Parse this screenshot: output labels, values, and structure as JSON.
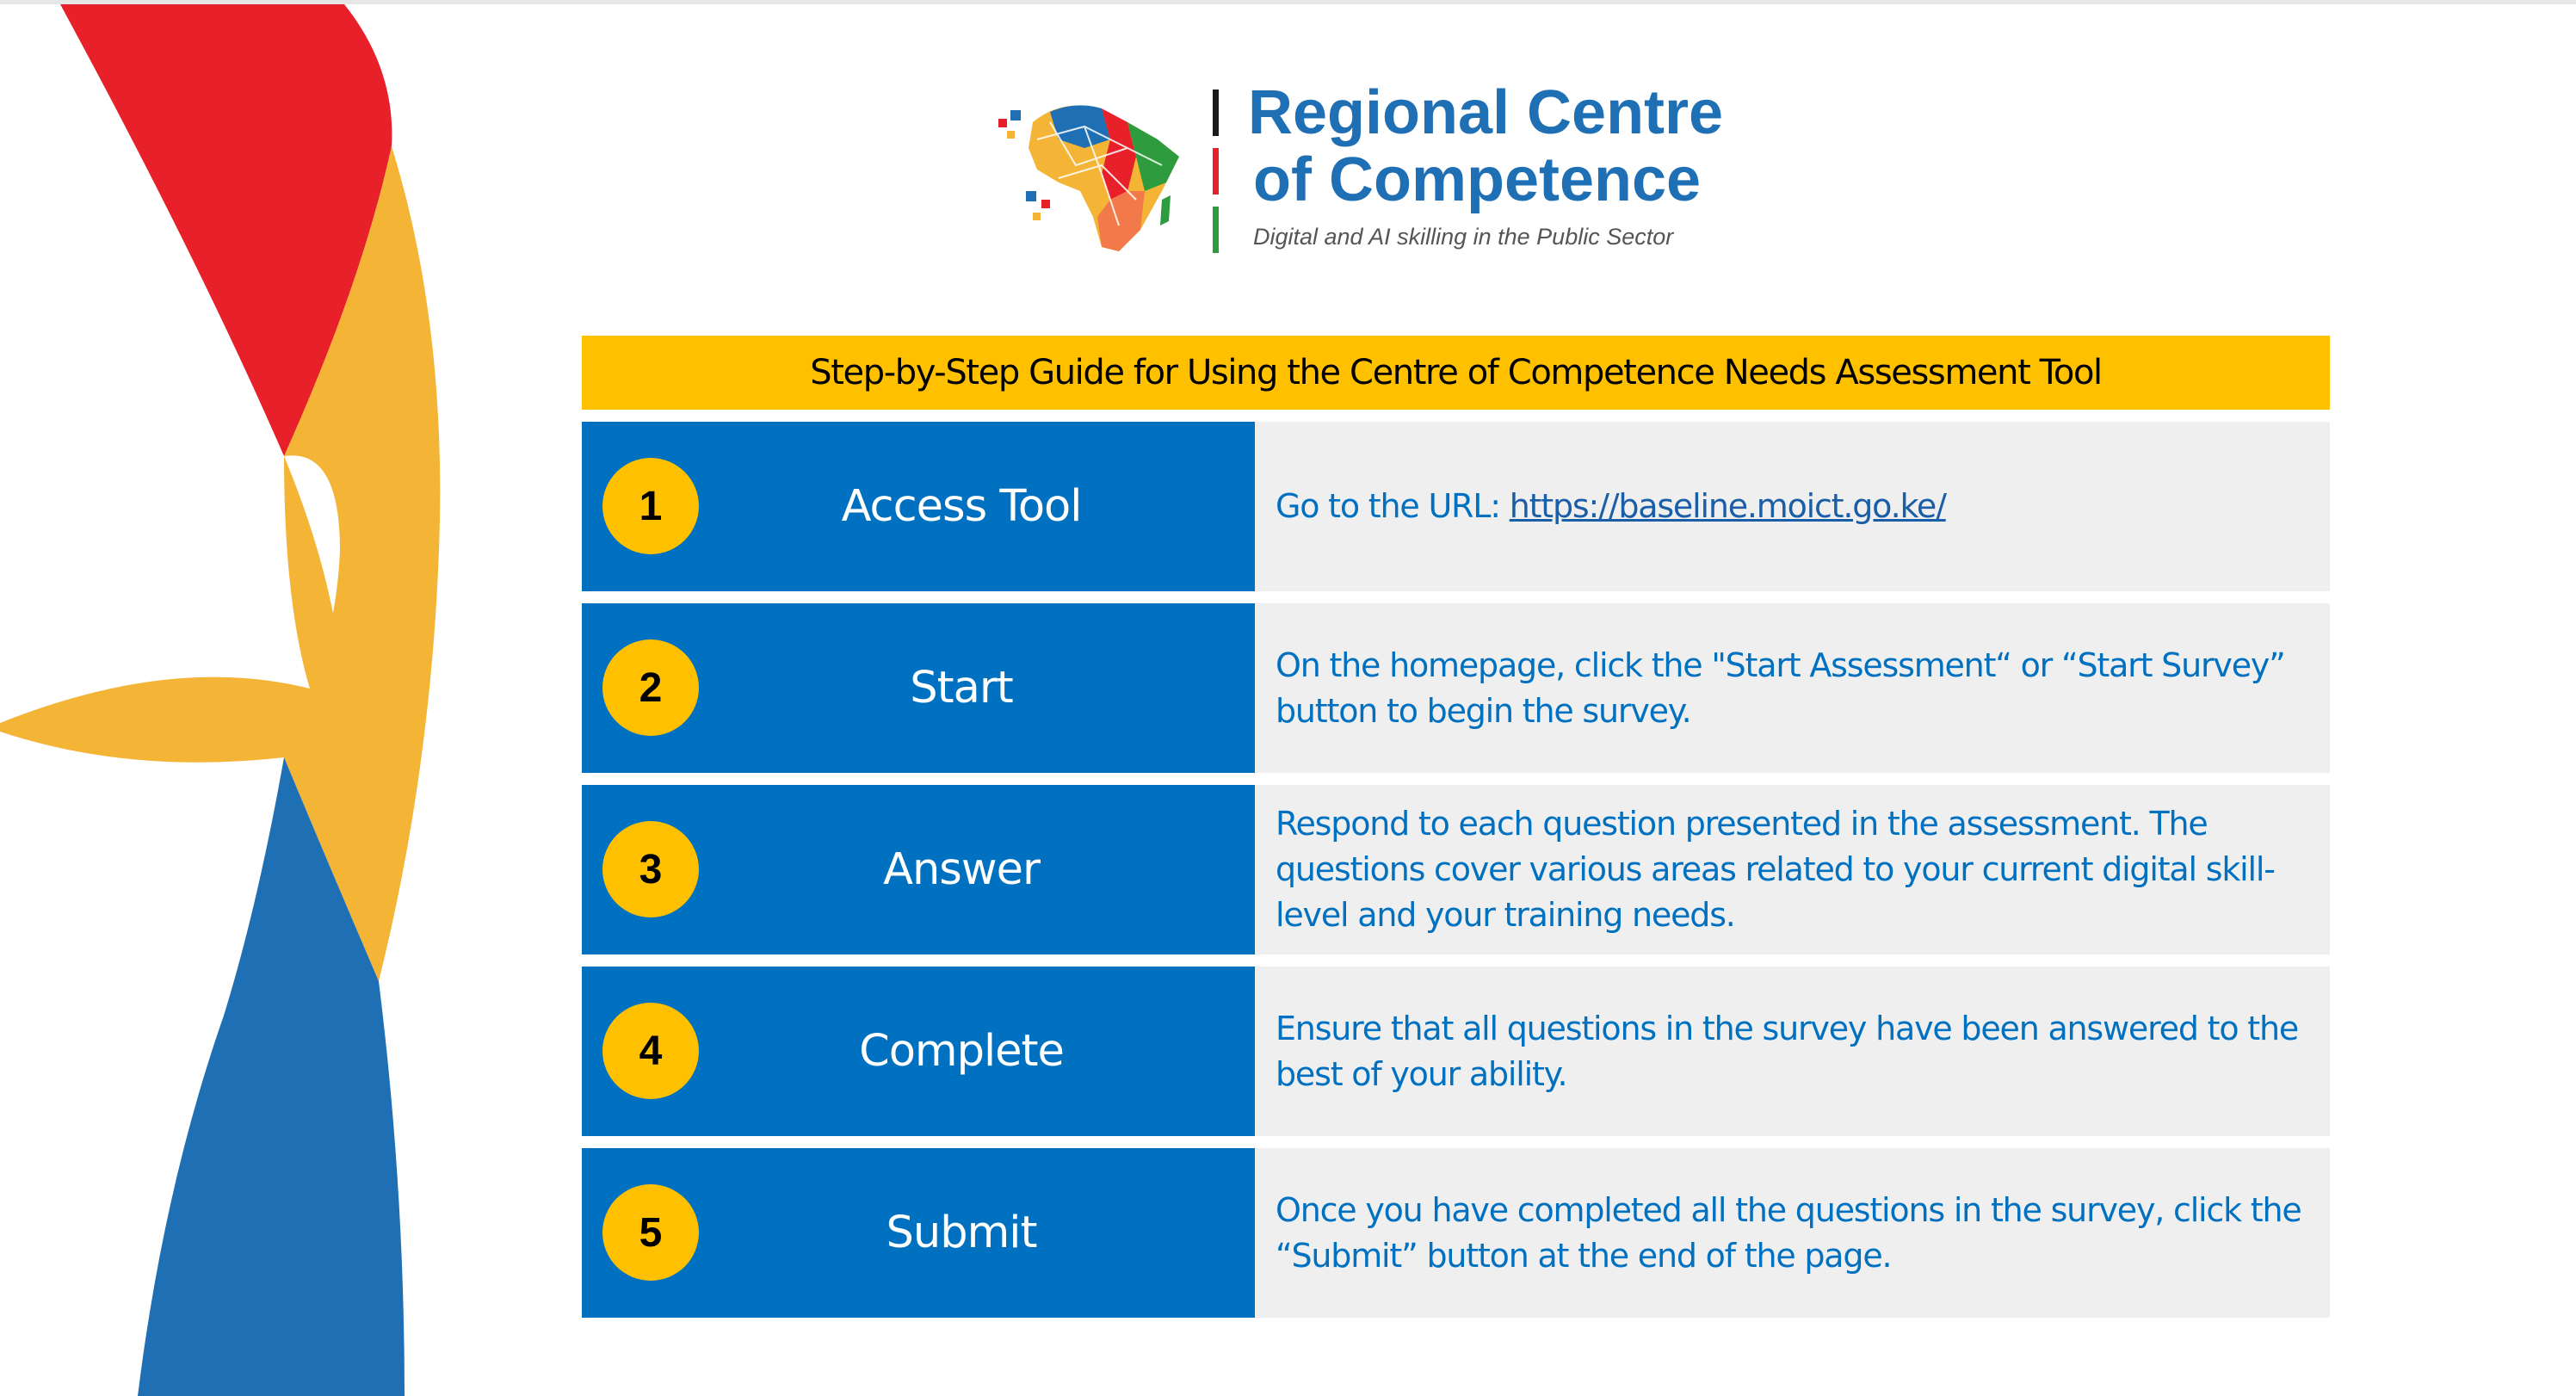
{
  "logo": {
    "title_line1": "Regional Centre",
    "title_line2": "of Competence",
    "tagline": "Digital and AI skilling in the Public Sector",
    "icon": "africa-map-logo-icon"
  },
  "guide": {
    "header": "Step-by-Step Guide for Using the Centre of Competence Needs Assessment Tool",
    "steps": [
      {
        "number": "1",
        "title": "Access Tool",
        "description_prefix": "Go to the URL: ",
        "link": "https://baseline.moict.go.ke/"
      },
      {
        "number": "2",
        "title": "Start",
        "description": "On the homepage, click the \"Start Assessment“ or “Start Survey” button to begin the survey."
      },
      {
        "number": "3",
        "title": "Answer",
        "description": "Respond to each question presented in the assessment. The questions cover various areas related to your current digital skill-level and your training needs."
      },
      {
        "number": "4",
        "title": "Complete",
        "description": "Ensure that all questions in the survey have been answered to the best of your ability."
      },
      {
        "number": "5",
        "title": "Submit",
        "description": "Once you have completed all the questions in the survey, click the “Submit” button at the end of the page."
      }
    ]
  },
  "colors": {
    "header_yellow": "#ffc000",
    "step_blue": "#0070c0",
    "description_bg": "#efefef",
    "deco_red": "#e8202a",
    "deco_orange": "#f4b436",
    "deco_blue": "#1f6fb5"
  }
}
